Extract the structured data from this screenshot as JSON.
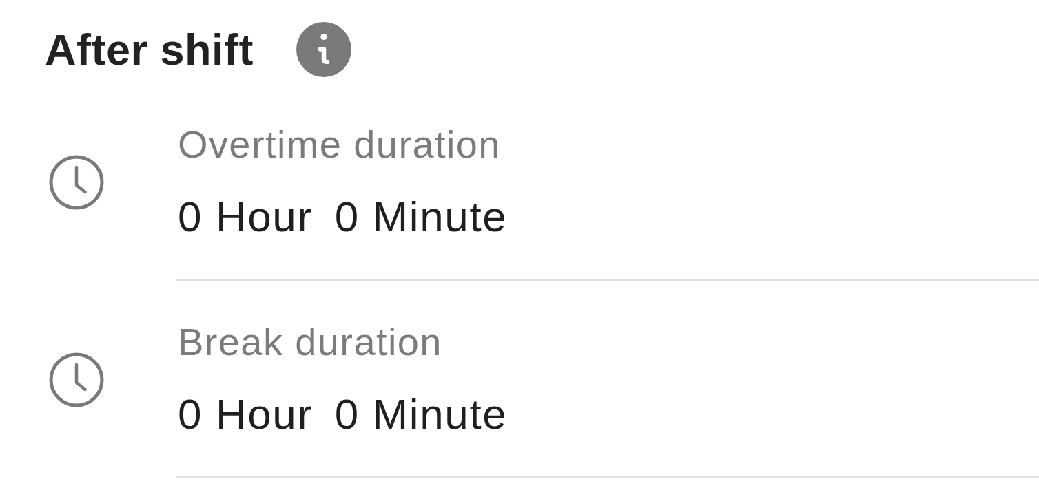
{
  "section_title": "After shift",
  "fields": [
    {
      "label": "Overtime duration",
      "hours": "0 Hour",
      "minutes": "0 Minute"
    },
    {
      "label": "Break duration",
      "hours": "0 Hour",
      "minutes": "0 Minute"
    }
  ]
}
